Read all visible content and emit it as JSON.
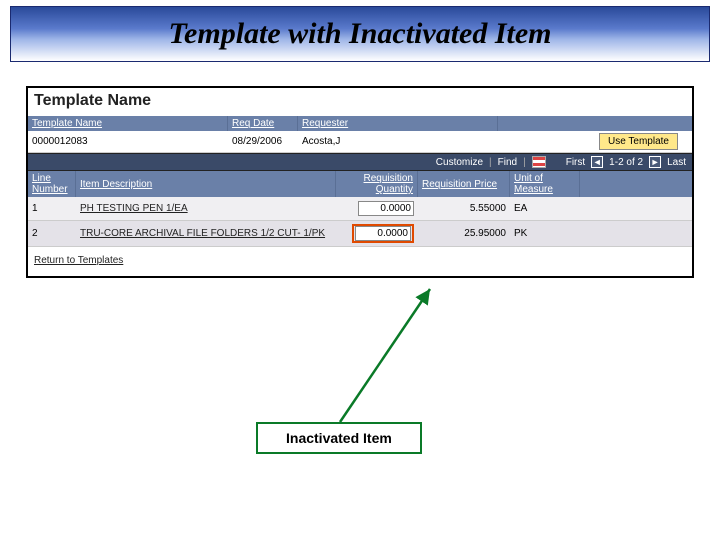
{
  "banner": {
    "title": "Template with Inactivated Item"
  },
  "section": {
    "title": "Template Name"
  },
  "template_header": {
    "cols": {
      "name": "Template Name",
      "req_date": "Req Date",
      "requester": "Requester"
    },
    "row": {
      "name": "0000012083",
      "req_date": "08/29/2006",
      "requester": "Acosta,J"
    },
    "use_template_btn": "Use Template"
  },
  "toolbar": {
    "customize": "Customize",
    "find": "Find",
    "first": "First",
    "range": "1-2 of 2",
    "last": "Last"
  },
  "grid": {
    "headers": {
      "line": "Line Number",
      "desc": "Item Description",
      "qty": "Requisition Quantity",
      "price": "Requisition Price",
      "uom": "Unit of Measure"
    },
    "rows": [
      {
        "line": "1",
        "desc": "PH TESTING PEN 1/EA",
        "qty": "0.0000",
        "price": "5.55000",
        "uom": "EA",
        "highlight": false
      },
      {
        "line": "2",
        "desc": "TRU-CORE ARCHIVAL FILE FOLDERS 1/2 CUT- 1/PK",
        "qty": "0.0000",
        "price": "25.95000",
        "uom": "PK",
        "highlight": true
      }
    ]
  },
  "return_link": "Return to Templates",
  "callout": {
    "label": "Inactivated Item"
  }
}
